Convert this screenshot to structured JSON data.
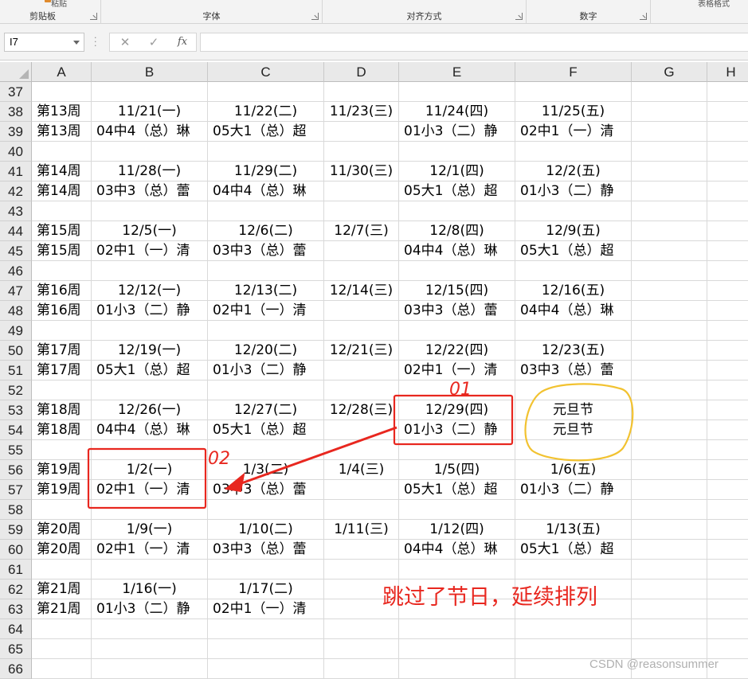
{
  "ribbon": {
    "groups": [
      {
        "label": "剪贴板"
      },
      {
        "label": "字体"
      },
      {
        "label": "对齐方式"
      },
      {
        "label": "数字"
      },
      {
        "label": ""
      }
    ],
    "cut_text_left": "粘贴",
    "cut_text_right": "表格格式"
  },
  "formula_bar": {
    "name_box": "I7",
    "cancel_icon": "✕",
    "enter_icon": "✓",
    "fx_label": "fx",
    "formula": ""
  },
  "columns": [
    "A",
    "B",
    "C",
    "D",
    "E",
    "F",
    "G",
    "H"
  ],
  "rows": [
    {
      "num": "37",
      "cells": [
        "",
        "",
        "",
        "",
        "",
        ""
      ]
    },
    {
      "num": "38",
      "cells": [
        "第13周",
        "11/21(一)",
        "11/22(二)",
        "11/23(三)",
        "11/24(四)",
        "11/25(五)"
      ]
    },
    {
      "num": "39",
      "cells": [
        "第13周",
        "04中4（总）琳",
        "05大1（总）超",
        "",
        "01小3（二）静",
        "02中1（一）清"
      ]
    },
    {
      "num": "40",
      "cells": [
        "",
        "",
        "",
        "",
        "",
        ""
      ]
    },
    {
      "num": "41",
      "cells": [
        "第14周",
        "11/28(一)",
        "11/29(二)",
        "11/30(三)",
        "12/1(四)",
        "12/2(五)"
      ]
    },
    {
      "num": "42",
      "cells": [
        "第14周",
        "03中3（总）蕾",
        "04中4（总）琳",
        "",
        "05大1（总）超",
        "01小3（二）静"
      ]
    },
    {
      "num": "43",
      "cells": [
        "",
        "",
        "",
        "",
        "",
        ""
      ]
    },
    {
      "num": "44",
      "cells": [
        "第15周",
        "12/5(一)",
        "12/6(二)",
        "12/7(三)",
        "12/8(四)",
        "12/9(五)"
      ]
    },
    {
      "num": "45",
      "cells": [
        "第15周",
        "02中1（一）清",
        "03中3（总）蕾",
        "",
        "04中4（总）琳",
        "05大1（总）超"
      ]
    },
    {
      "num": "46",
      "cells": [
        "",
        "",
        "",
        "",
        "",
        ""
      ]
    },
    {
      "num": "47",
      "cells": [
        "第16周",
        "12/12(一)",
        "12/13(二)",
        "12/14(三)",
        "12/15(四)",
        "12/16(五)"
      ]
    },
    {
      "num": "48",
      "cells": [
        "第16周",
        "01小3（二）静",
        "02中1（一）清",
        "",
        "03中3（总）蕾",
        "04中4（总）琳"
      ]
    },
    {
      "num": "49",
      "cells": [
        "",
        "",
        "",
        "",
        "",
        ""
      ]
    },
    {
      "num": "50",
      "cells": [
        "第17周",
        "12/19(一)",
        "12/20(二)",
        "12/21(三)",
        "12/22(四)",
        "12/23(五)"
      ]
    },
    {
      "num": "51",
      "cells": [
        "第17周",
        "05大1（总）超",
        "01小3（二）静",
        "",
        "02中1（一）清",
        "03中3（总）蕾"
      ]
    },
    {
      "num": "52",
      "cells": [
        "",
        "",
        "",
        "",
        "",
        ""
      ]
    },
    {
      "num": "53",
      "cells": [
        "第18周",
        "12/26(一)",
        "12/27(二)",
        "12/28(三)",
        "12/29(四)",
        "元旦节"
      ]
    },
    {
      "num": "54",
      "cells": [
        "第18周",
        "04中4（总）琳",
        "05大1（总）超",
        "",
        "01小3（二）静",
        "元旦节"
      ]
    },
    {
      "num": "55",
      "cells": [
        "",
        "",
        "",
        "",
        "",
        ""
      ]
    },
    {
      "num": "56",
      "cells": [
        "第19周",
        "1/2(一)",
        "1/3(二)",
        "1/4(三)",
        "1/5(四)",
        "1/6(五)"
      ]
    },
    {
      "num": "57",
      "cells": [
        "第19周",
        "02中1（一）清",
        "03中3（总）蕾",
        "",
        "05大1（总）超",
        "01小3（二）静"
      ]
    },
    {
      "num": "58",
      "cells": [
        "",
        "",
        "",
        "",
        "",
        ""
      ]
    },
    {
      "num": "59",
      "cells": [
        "第20周",
        "1/9(一)",
        "1/10(二)",
        "1/11(三)",
        "1/12(四)",
        "1/13(五)"
      ]
    },
    {
      "num": "60",
      "cells": [
        "第20周",
        "02中1（一）清",
        "03中3（总）蕾",
        "",
        "04中4（总）琳",
        "05大1（总）超"
      ]
    },
    {
      "num": "61",
      "cells": [
        "",
        "",
        "",
        "",
        "",
        ""
      ]
    },
    {
      "num": "62",
      "cells": [
        "第21周",
        "1/16(一)",
        "1/17(二)",
        "",
        "",
        ""
      ]
    },
    {
      "num": "63",
      "cells": [
        "第21周",
        "01小3（二）静",
        "02中1（一）清",
        "",
        "",
        ""
      ]
    },
    {
      "num": "64",
      "cells": [
        "",
        "",
        "",
        "",
        "",
        ""
      ]
    },
    {
      "num": "65",
      "cells": [
        "",
        "",
        "",
        "",
        "",
        ""
      ]
    },
    {
      "num": "66",
      "cells": [
        "",
        "",
        "",
        "",
        "",
        ""
      ]
    }
  ],
  "annotations": {
    "note": "跳过了节日，延续排列",
    "mark_1": "01",
    "mark_2": "02",
    "color_red": "#e8271f",
    "color_yellow": "#f2c230"
  },
  "watermark": "CSDN @reasonsummer"
}
